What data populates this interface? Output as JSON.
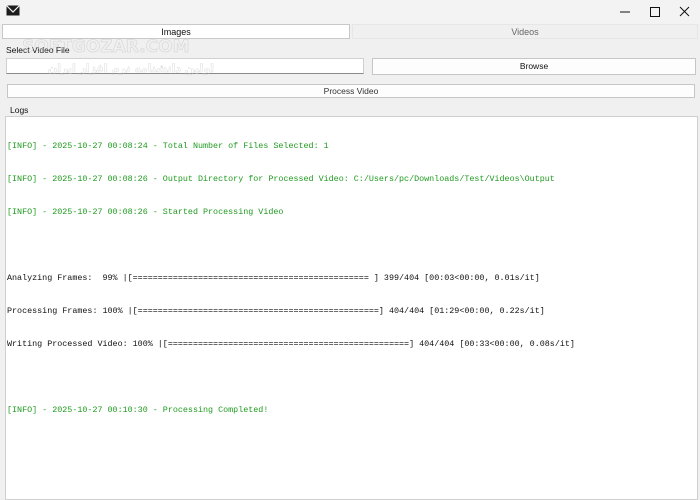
{
  "window": {
    "icon": "envelope-icon",
    "controls": [
      "minimize-icon",
      "maximize-icon",
      "close-icon"
    ]
  },
  "tabs": [
    {
      "label": "Images",
      "active": true
    },
    {
      "label": "Videos",
      "active": false
    }
  ],
  "form": {
    "select_label": "Select Video File",
    "path_value": "",
    "browse_label": "Browse",
    "process_label": "Process Video"
  },
  "logs": {
    "label": "Logs",
    "lines": [
      {
        "kind": "info",
        "text": "[INFO] - 2025-10-27 00:08:24 - Total Number of Files Selected: 1"
      },
      {
        "kind": "info",
        "text": "[INFO] - 2025-10-27 00:08:26 - Output Directory for Processed Video: C:/Users/pc/Downloads/Test/Videos\\Output"
      },
      {
        "kind": "info",
        "text": "[INFO] - 2025-10-27 00:08:26 - Started Processing Video"
      },
      {
        "kind": "blank",
        "text": ""
      },
      {
        "kind": "plain",
        "text": "Analyzing Frames:  99% |[=============================================== ] 399/404 [00:03<00:00, 0.01s/it]"
      },
      {
        "kind": "plain",
        "text": "Processing Frames: 100% |[================================================] 404/404 [01:29<00:00, 0.22s/it]"
      },
      {
        "kind": "plain",
        "text": "Writing Processed Video: 100% |[================================================] 404/404 [00:33<00:00, 0.08s/it]"
      },
      {
        "kind": "blank",
        "text": ""
      },
      {
        "kind": "info",
        "text": "[INFO] - 2025-10-27 00:10:30 - Processing Completed!"
      }
    ]
  },
  "watermark": {
    "line1": "SOFTGOZAR.COM",
    "line2": "اولین دانشنامه نرم افزار ایران"
  },
  "colors": {
    "info": "#1f9a1f",
    "accent_red": "#e23b2e"
  }
}
